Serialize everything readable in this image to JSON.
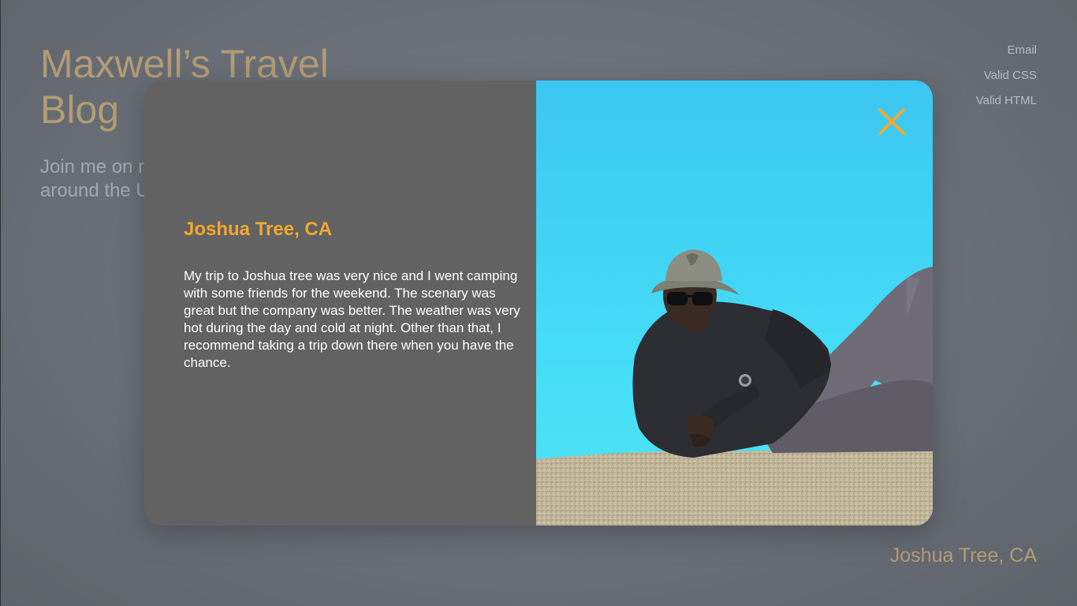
{
  "background": {
    "title": "Maxwell’s Travel Blog",
    "intro": "Join me on my journey around the United States",
    "links": [
      "Email",
      "Valid CSS",
      "Valid HTML"
    ],
    "caption": "Joshua Tree, CA"
  },
  "modal": {
    "heading": "Joshua Tree, CA",
    "body": "My trip to Joshua tree was very nice and I went camping with some friends for the weekend. The scenary was great but the company was better. The weather was very hot during the day and cold at night. Other than that, I recommend taking a trip down there when you have the chance.",
    "close_icon": "close-icon",
    "photo_icon": "photo-man-lying-on-rock"
  },
  "colors": {
    "accent": "#f2a830",
    "title_gold": "#b39c74",
    "panel": "#626262",
    "sky": "#3fd0f5"
  }
}
